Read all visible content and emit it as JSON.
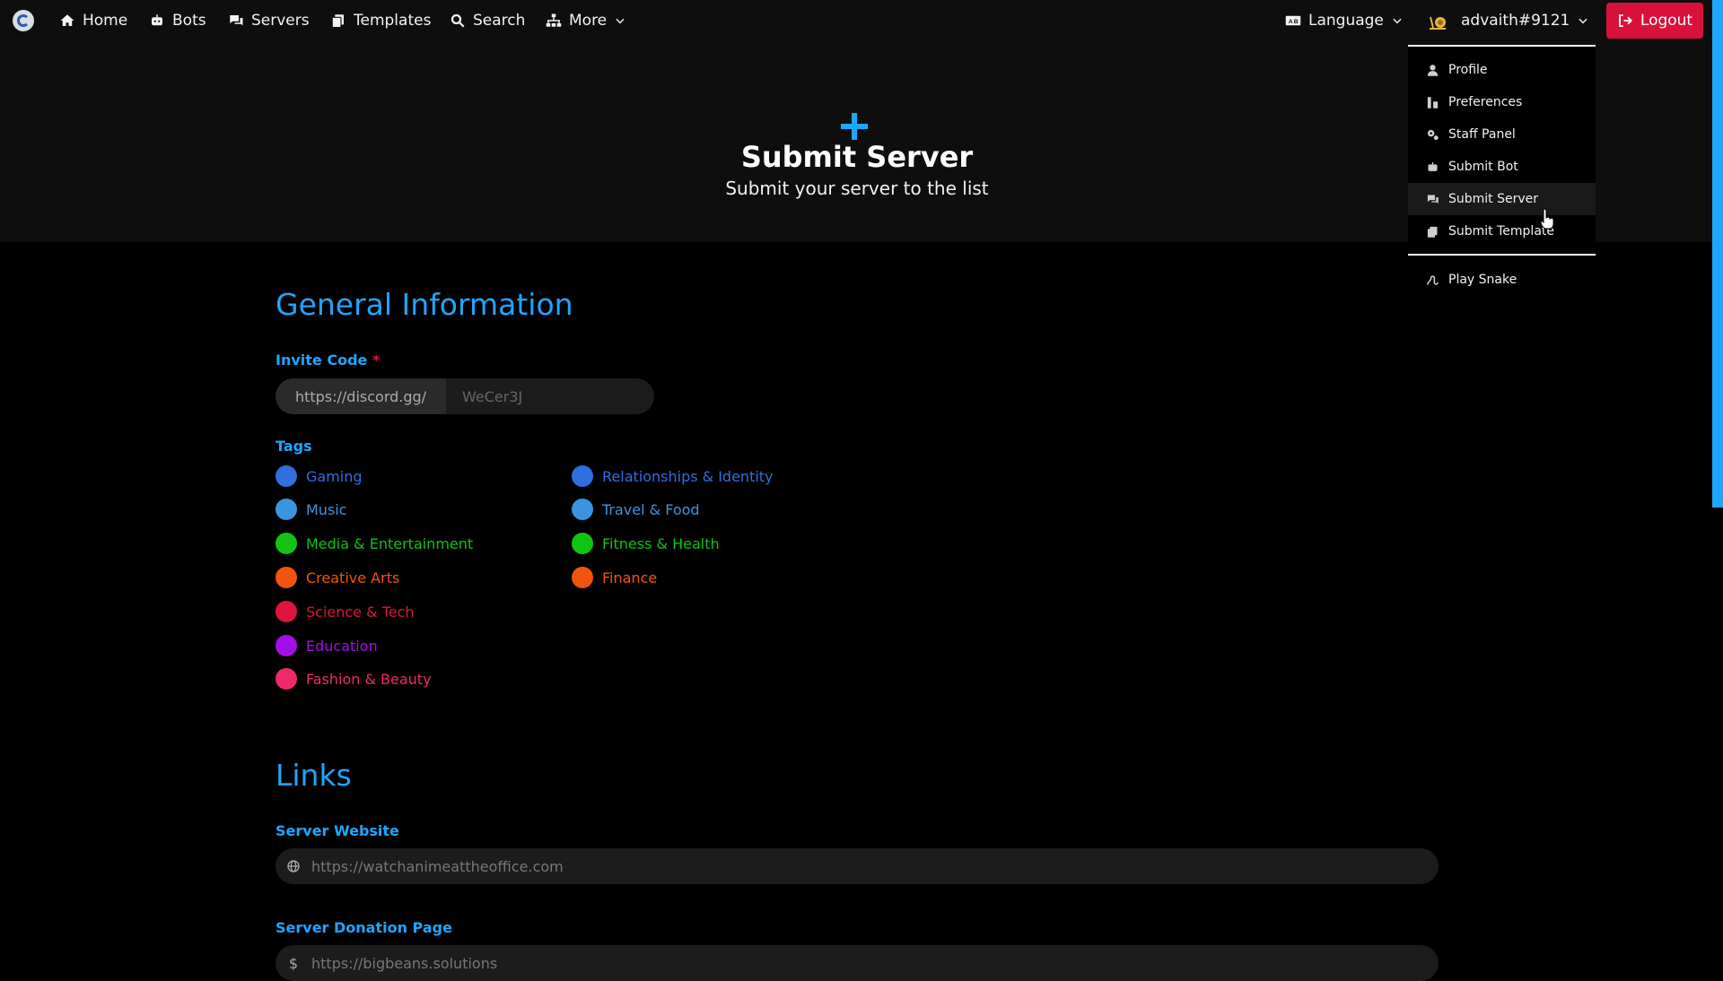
{
  "nav": {
    "home": "Home",
    "bots": "Bots",
    "servers": "Servers",
    "templates": "Templates",
    "search": "Search",
    "more": "More",
    "language": "Language",
    "user": "advaith#9121",
    "logout": "Logout"
  },
  "hero": {
    "title": "Submit Server",
    "subtitle": "Submit your server to the list"
  },
  "general": {
    "title": "General Information",
    "invite_label": "Invite Code",
    "required_mark": "*",
    "invite_prefix": "https://discord.gg/",
    "invite_placeholder": "WeCer3J",
    "tags_label": "Tags",
    "tags_col1": [
      {
        "label": "Gaming",
        "color": "#2f6fe0"
      },
      {
        "label": "Music",
        "color": "#3a95e0"
      },
      {
        "label": "Media & Entertainment",
        "color": "#11c411"
      },
      {
        "label": "Creative Arts",
        "color": "#f2540d"
      },
      {
        "label": "Science & Tech",
        "color": "#e0143c"
      },
      {
        "label": "Education",
        "color": "#a40ee8"
      },
      {
        "label": "Fashion & Beauty",
        "color": "#f02a6a"
      }
    ],
    "tags_col2": [
      {
        "label": "Relationships & Identity",
        "color": "#2f6fe0"
      },
      {
        "label": "Travel & Food",
        "color": "#3a95e0"
      },
      {
        "label": "Fitness & Health",
        "color": "#11c411"
      },
      {
        "label": "Finance",
        "color": "#f2540d"
      }
    ]
  },
  "links": {
    "title": "Links",
    "website_label": "Server Website",
    "website_placeholder": "https://watchanimeattheoffice.com",
    "donation_label": "Server Donation Page",
    "donation_placeholder": "https://bigbeans.solutions",
    "donation_icon": "$"
  },
  "dropdown": {
    "items": [
      {
        "label": "Profile",
        "icon": "user-icon"
      },
      {
        "label": "Preferences",
        "icon": "sliders-icon"
      },
      {
        "label": "Staff Panel",
        "icon": "gears-icon"
      },
      {
        "label": "Submit Bot",
        "icon": "robot-icon"
      },
      {
        "label": "Submit Server",
        "icon": "comments-icon"
      },
      {
        "label": "Submit Template",
        "icon": "copy-icon"
      }
    ],
    "extra": {
      "label": "Play Snake",
      "icon": "snake-icon"
    }
  },
  "colors": {
    "accent": "#1ea6ff",
    "logout": "#d9113a",
    "background": "#000000",
    "header": "#0e0e0e"
  }
}
